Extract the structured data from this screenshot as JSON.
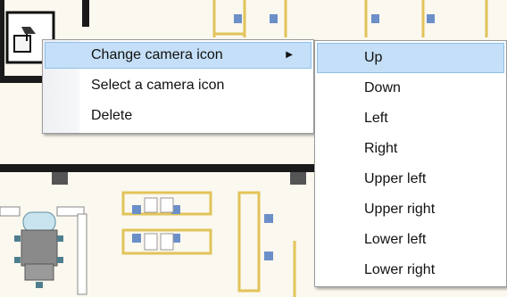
{
  "context_menu": {
    "items": [
      {
        "label": "Change camera icon",
        "has_submenu": true,
        "highlighted": true
      },
      {
        "label": "Select a camera icon",
        "has_submenu": false,
        "highlighted": false
      },
      {
        "label": "Delete",
        "has_submenu": false,
        "highlighted": false
      }
    ]
  },
  "submenu": {
    "items": [
      {
        "label": "Up",
        "highlighted": true
      },
      {
        "label": "Down"
      },
      {
        "label": "Left"
      },
      {
        "label": "Right"
      },
      {
        "label": "Upper left"
      },
      {
        "label": "Upper right"
      },
      {
        "label": "Lower left"
      },
      {
        "label": "Lower right"
      }
    ]
  },
  "icons": {
    "camera": "camera-icon",
    "submenu_arrow": "submenu-arrow-icon"
  },
  "colors": {
    "highlight": "#c4dff7",
    "highlight_border": "#8fc0ea",
    "floor_background": "#faf8ef",
    "wall": "#1a1a1a",
    "desk": "#e2c35a",
    "chair": "#6b8fc8",
    "meeting_table": "#c9e4ee"
  }
}
